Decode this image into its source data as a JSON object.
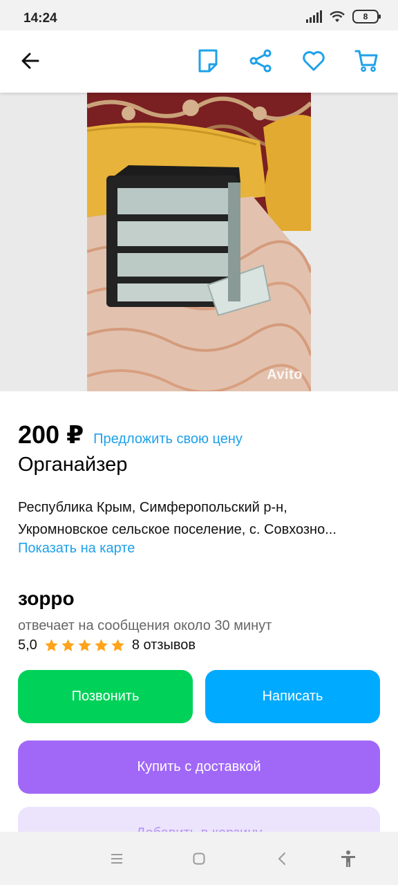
{
  "status_bar": {
    "time": "14:24",
    "battery": "8",
    "icons": [
      "signal-icon",
      "wifi-icon",
      "battery-icon"
    ]
  },
  "app_bar": {
    "icons": [
      "back-arrow-icon",
      "note-icon",
      "share-icon",
      "heart-icon",
      "cart-icon"
    ],
    "accent_color": "#1ea1e9"
  },
  "photo": {
    "watermark": "Avito"
  },
  "listing": {
    "price": "200 ₽",
    "offer_price_link": "Предложить свою цену",
    "title": "Органайзер",
    "address_line1": "Республика Крым, Симферопольский р-н,",
    "address_line2": "Укромновское сельское поселение, с. Совхозно...",
    "show_on_map": "Показать на карте"
  },
  "seller": {
    "name": "зорро",
    "reply_time": "отвечает на сообщения около 30 минут",
    "rating": "5,0",
    "stars": 5,
    "reviews": "8 отзывов"
  },
  "actions": {
    "call": "Позвонить",
    "write": "Написать",
    "buy_delivery": "Купить с доставкой",
    "add_to_cart": "Добавить в корзину",
    "colors": {
      "call": "#00d259",
      "write": "#00aaff",
      "buy": "#a168f7",
      "cart": "#ece3fd"
    }
  },
  "nav_bar": {
    "icons": [
      "menu-icon",
      "home-icon",
      "back-icon",
      "accessibility-icon"
    ]
  }
}
